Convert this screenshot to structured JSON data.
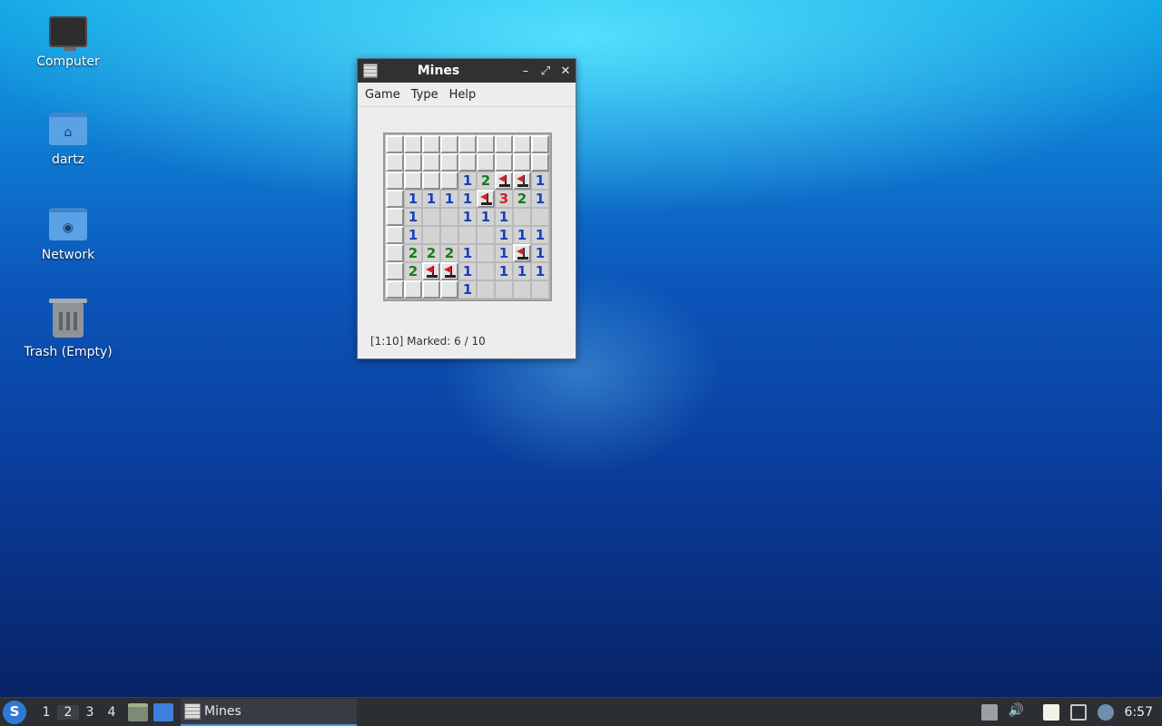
{
  "desktop": {
    "icons": [
      {
        "label": "Computer",
        "icon": "computer-icon"
      },
      {
        "label": "dartz",
        "icon": "home-folder-icon"
      },
      {
        "label": "Network",
        "icon": "network-folder-icon"
      },
      {
        "label": "Trash (Empty)",
        "icon": "trash-icon"
      }
    ]
  },
  "window": {
    "title": "Mines",
    "menu": [
      "Game",
      "Type",
      "Help"
    ],
    "controls": {
      "minimize": "–",
      "maximize": "⤢",
      "close": "✕"
    },
    "status": "[1:10] Marked: 6 / 10",
    "board": [
      [
        "c",
        "c",
        "c",
        "c",
        "c",
        "c",
        "c",
        "c",
        "c"
      ],
      [
        "c",
        "c",
        "c",
        "c",
        "c",
        "c",
        "c",
        "c",
        "c"
      ],
      [
        "c",
        "c",
        "c",
        "c",
        "1",
        "2",
        "F",
        "F",
        "1"
      ],
      [
        "c",
        "1",
        "1",
        "1",
        "1",
        "F",
        "3",
        "2",
        "1"
      ],
      [
        "c",
        "1",
        "",
        "",
        "1",
        "1",
        "1",
        "",
        ""
      ],
      [
        "c",
        "1",
        "",
        "",
        "",
        "",
        "1",
        "1",
        "1"
      ],
      [
        "c",
        "2",
        "2",
        "2",
        "1",
        "",
        "1",
        "F",
        "1"
      ],
      [
        "c",
        "2",
        "F",
        "F",
        "1",
        "",
        "1",
        "1",
        "1"
      ],
      [
        "c",
        "c",
        "c",
        "c",
        "1",
        "",
        "",
        "",
        ""
      ]
    ]
  },
  "taskbar": {
    "workspaces": [
      "1",
      "2",
      "3",
      "4"
    ],
    "active_workspace": "2",
    "task_label": "Mines",
    "clock": "6:57"
  }
}
